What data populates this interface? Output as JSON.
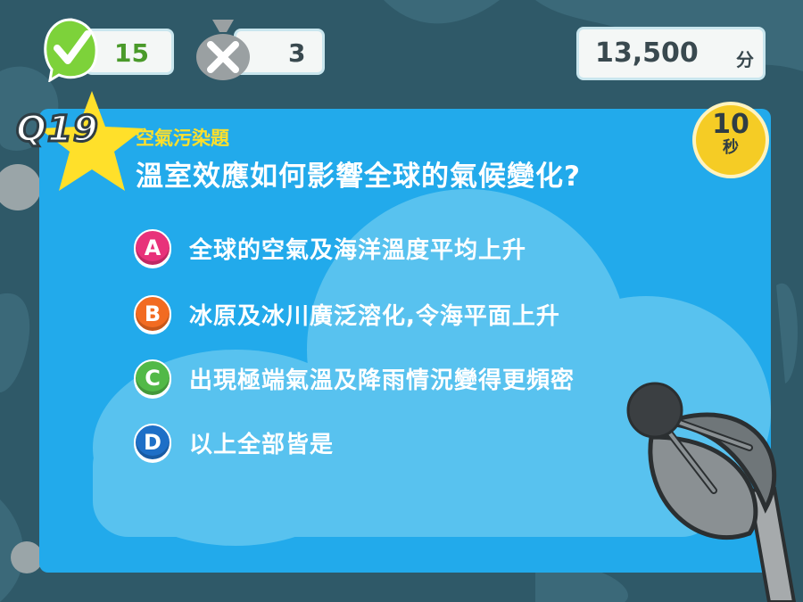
{
  "colors": {
    "background": "#2f5968",
    "panel": "#22aaeb",
    "correct": "#7dd23a",
    "wrong": "#9aa0a2",
    "badge_a": "#e8327a",
    "badge_b": "#f26b21",
    "badge_c": "#52b947",
    "badge_d": "#1e6fc7",
    "question_number": "#ffe02a",
    "timer": "#f5cc25"
  },
  "stats": {
    "correct_icon": "check-leaf-icon",
    "correct_count": "15",
    "wrong_icon": "x-bag-icon",
    "wrong_count": "3"
  },
  "score": {
    "value": "13,500",
    "unit": "分"
  },
  "question": {
    "number": "Q19",
    "category": "空氣污染題",
    "text": "溫室效應如何影響全球的氣候變化?"
  },
  "timer": {
    "value": "10",
    "unit": "秒"
  },
  "options": [
    {
      "letter": "A",
      "text": "全球的空氣及海洋溫度平均上升"
    },
    {
      "letter": "B",
      "text": "冰原及冰川廣泛溶化,令海平面上升"
    },
    {
      "letter": "C",
      "text": "出現極端氣溫及降雨情況變得更頻密"
    },
    {
      "letter": "D",
      "text": "以上全部皆是"
    }
  ]
}
